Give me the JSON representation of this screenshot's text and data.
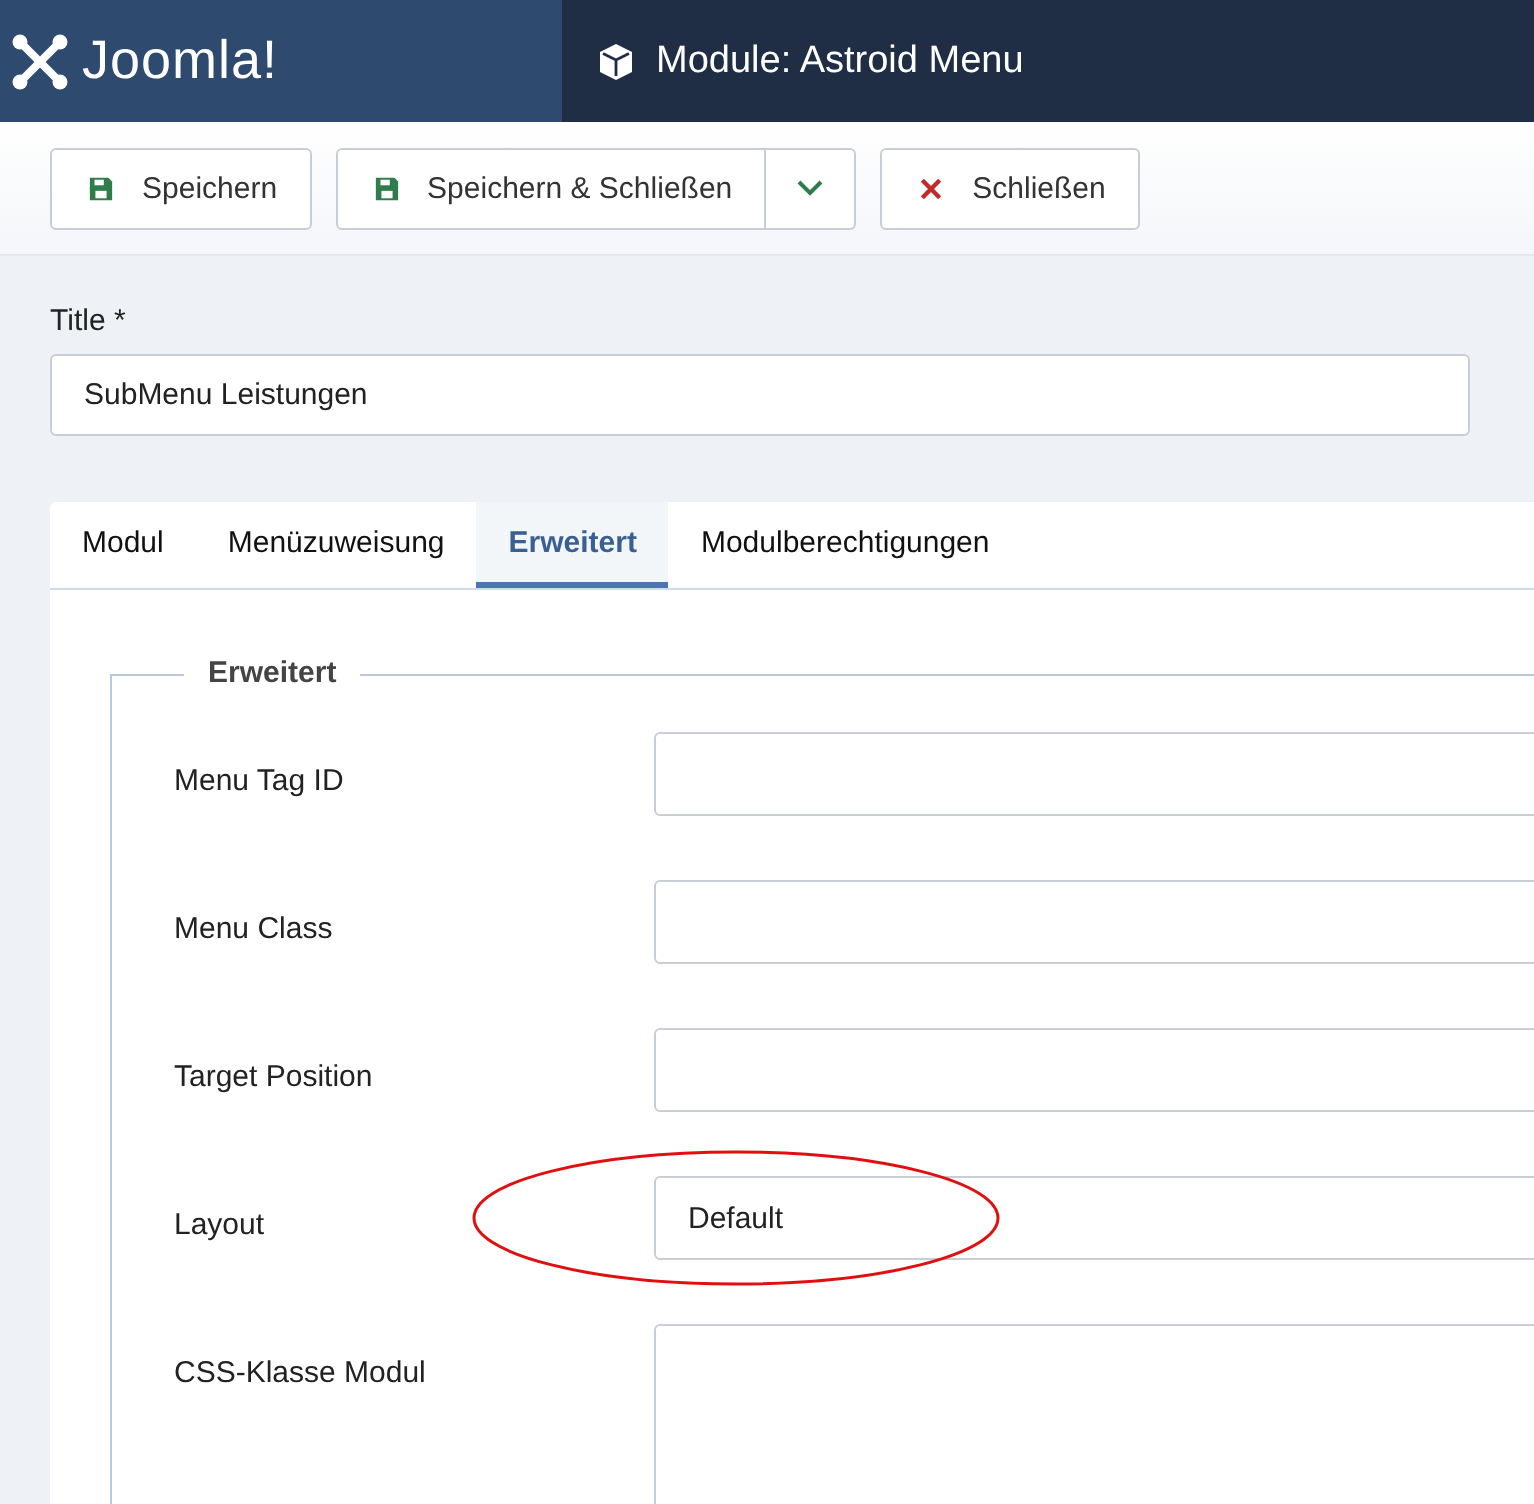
{
  "header": {
    "brand": "Joomla!",
    "title": "Module: Astroid Menu"
  },
  "toolbar": [
    {
      "kind": "save",
      "label": "Speichern"
    },
    {
      "kind": "save-close",
      "label": "Speichern & Schließen"
    },
    {
      "kind": "close",
      "label": "Schließen"
    }
  ],
  "title_field": {
    "label": "Title *",
    "value": "SubMenu Leistungen"
  },
  "tabs": [
    {
      "label": "Modul",
      "selected": false
    },
    {
      "label": "Menüzuweisung",
      "selected": false
    },
    {
      "label": "Erweitert",
      "selected": true
    },
    {
      "label": "Modulberechtigungen",
      "selected": false
    }
  ],
  "fieldset": {
    "legend": "Erweitert",
    "fields": [
      {
        "label": "Menu Tag ID",
        "kind": "input",
        "circled": false
      },
      {
        "label": "Menu Class",
        "kind": "input",
        "circled": false
      },
      {
        "label": "Target Position",
        "kind": "input",
        "circled": false
      },
      {
        "label": "Layout",
        "kind": "input",
        "value": "Default",
        "circled": true
      },
      {
        "label": "CSS-Klasse Modul",
        "kind": "textarea",
        "circled": false
      }
    ]
  }
}
